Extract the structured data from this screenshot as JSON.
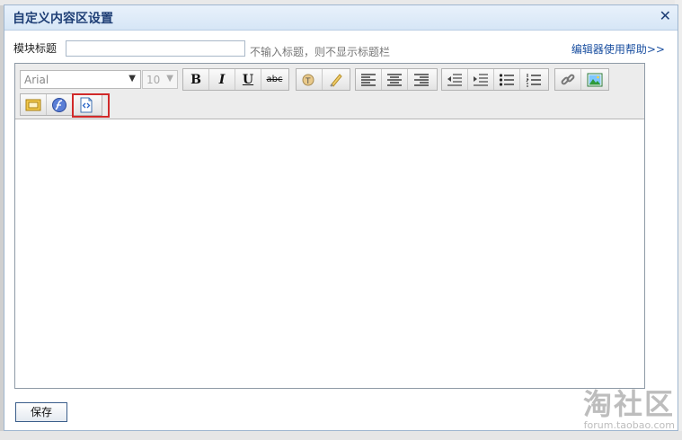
{
  "dialog": {
    "title": "自定义内容区设置",
    "close_glyph": "✕"
  },
  "form": {
    "title_label": "模块标题",
    "title_value": "",
    "hint": "不输入标题，则不显示标题栏",
    "help_link": "编辑器使用帮助>>"
  },
  "toolbar": {
    "font_family": "Arial",
    "font_size": "10",
    "bold": "B",
    "italic": "I",
    "underline": "U",
    "strike": "abc",
    "icons": [
      "text-color-icon",
      "highlight-icon",
      "align-left-icon",
      "align-center-icon",
      "align-right-icon",
      "outdent-icon",
      "indent-icon",
      "bullet-list-icon",
      "numbered-list-icon",
      "link-icon",
      "image-icon",
      "media-icon",
      "flash-icon",
      "html-source-icon"
    ]
  },
  "editor": {
    "content": ""
  },
  "footer": {
    "save_label": "保存"
  },
  "watermark": {
    "main": "淘社区",
    "sub": "forum.taobao.com"
  },
  "colors": {
    "title_text": "#1f3f76",
    "highlight_border": "#d12a2a",
    "link": "#1a4fa0"
  }
}
